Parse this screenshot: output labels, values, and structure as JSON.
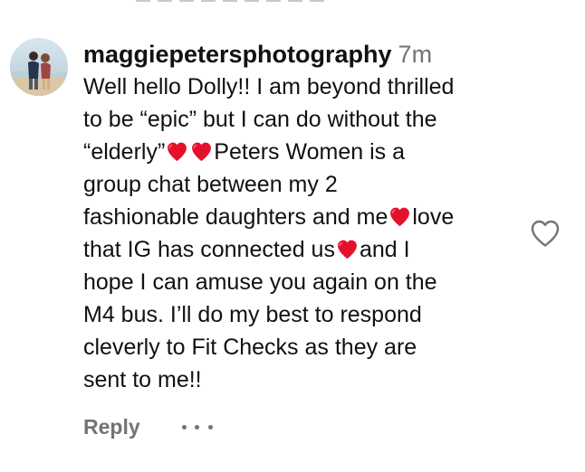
{
  "comment": {
    "username": "maggiepetersphotography",
    "timestamp": "7m",
    "lines": [
      [
        "Well hello Dolly!! I am beyond thrilled"
      ],
      [
        "to be “epic” but I can do without the"
      ],
      [
        "“elderly”",
        "❤️",
        "❤️",
        "Peters Women is a"
      ],
      [
        "group chat between my 2"
      ],
      [
        "fashionable daughters and me",
        "❤️",
        "love"
      ],
      [
        "that IG has connected us",
        "❤️",
        "and I"
      ],
      [
        "hope I can amuse you again on the"
      ],
      [
        "M4 bus. I’ll do my best to respond"
      ],
      [
        "cleverly to Fit Checks as they are"
      ],
      [
        "sent to me!!"
      ]
    ],
    "reply_label": "Reply",
    "more_options_icon": "more-horizontal-icon",
    "like_icon": "heart-outline-icon",
    "avatar_icon": "profile-avatar"
  },
  "colors": {
    "text": "#111111",
    "muted": "#737373",
    "heart": "#e4112c",
    "background": "#ffffff"
  }
}
